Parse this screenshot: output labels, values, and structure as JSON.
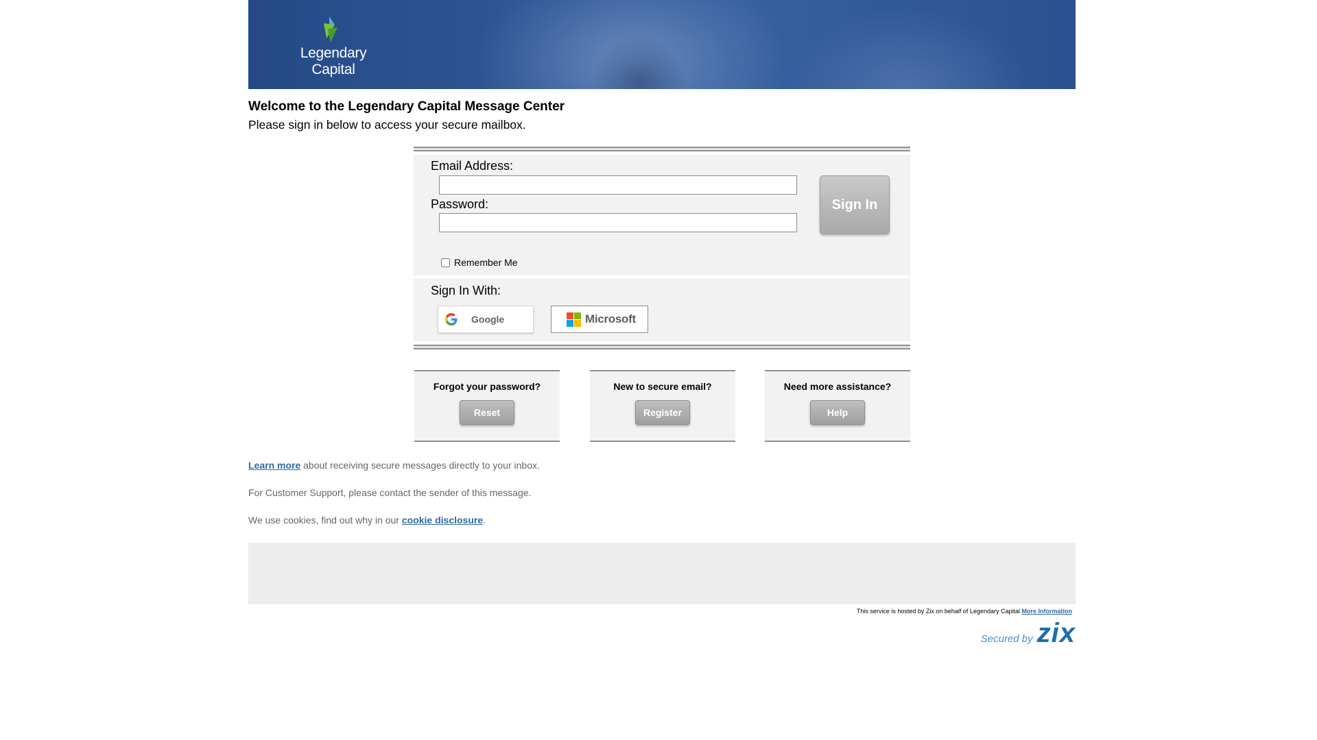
{
  "header": {
    "logo_text": "Legendary Capital"
  },
  "welcome": {
    "title": "Welcome to the Legendary Capital Message Center",
    "subtitle": "Please sign in below to access your secure mailbox."
  },
  "signin": {
    "email_label": "Email Address:",
    "email_value": "",
    "password_label": "Password:",
    "password_value": "",
    "signin_button": "Sign In",
    "remember_label": "Remember Me",
    "sign_in_with_label": "Sign In With:",
    "google_label": "Google",
    "microsoft_label": "Microsoft"
  },
  "help": [
    {
      "question": "Forgot your password?",
      "button": "Reset"
    },
    {
      "question": "New to secure email?",
      "button": "Register"
    },
    {
      "question": "Need more assistance?",
      "button": "Help"
    }
  ],
  "info": {
    "learn_more_link": "Learn more",
    "learn_more_text": " about receiving secure messages directly to your inbox.",
    "support_text": "For Customer Support, please contact the sender of this message.",
    "cookie_prefix": "We use cookies, find out why in our ",
    "cookie_link": "cookie disclosure",
    "cookie_suffix": "."
  },
  "footer": {
    "hosted_text": "This service is hosted by Zix on behalf of Legendary Capital ",
    "more_info_link": "More Information",
    "secured_by": "Secured by",
    "zix_logo": "zix"
  },
  "colors": {
    "banner": "#2f5795",
    "link": "#2f6aa3",
    "panel": "#f2f2f2",
    "button_gray": "#a9a9a9",
    "zix_blue": "#1a6fb0"
  },
  "icons": {
    "logo_mark": "legendary-capital-mark-icon",
    "google": "google-g-icon",
    "microsoft": "microsoft-logo-icon"
  }
}
